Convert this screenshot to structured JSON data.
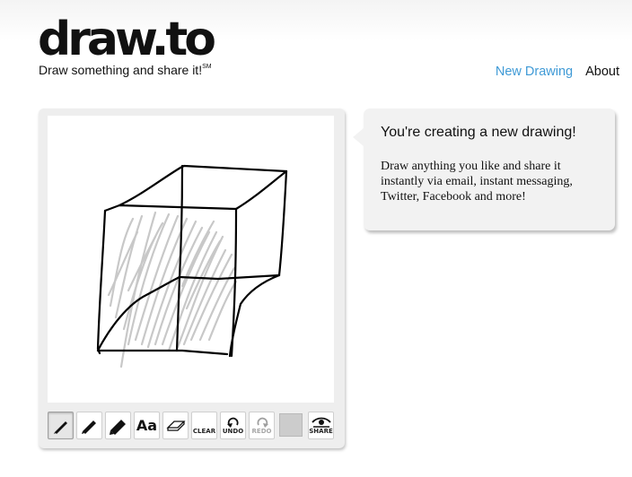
{
  "app": {
    "logo": "draw.to",
    "tagline": "Draw something and share it!",
    "tagline_mark": "SM"
  },
  "nav": {
    "new_drawing": "New Drawing",
    "about": "About"
  },
  "info": {
    "title": "You're creating a new drawing!",
    "body": "Draw anything you like and share it instantly via email, instant messaging, Twitter, Facebook and more!"
  },
  "toolbar": {
    "text_tool": "Aa",
    "clear": "CLEAR",
    "undo": "UNDO",
    "redo": "REDO",
    "share": "SHARE",
    "icons": [
      "pencil-thin-icon",
      "pencil-medium-icon",
      "pencil-thick-icon",
      "text-icon",
      "eraser-icon",
      "clear-icon",
      "undo-icon",
      "redo-icon",
      "color-swatch",
      "share-icon"
    ]
  },
  "colors": {
    "link": "#3f9ad6",
    "panel": "#eeeeee",
    "bubble": "#f2f2f2",
    "current_color": "#cccccc",
    "ink": "#000000",
    "shading": "#c8c8c8"
  }
}
